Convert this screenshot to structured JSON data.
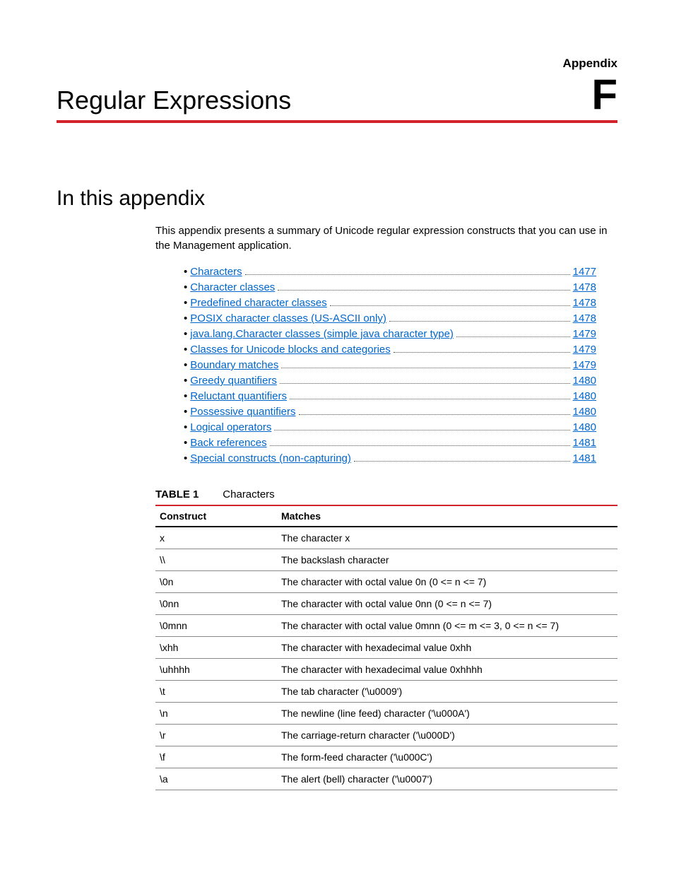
{
  "header": {
    "appendix_label": "Appendix",
    "title": "Regular Expressions",
    "letter": "F"
  },
  "section": {
    "heading": "In this appendix",
    "intro": "This appendix presents a summary of Unicode regular expression constructs that you can use in the Management application."
  },
  "toc": [
    {
      "label": "Characters",
      "page": "1477"
    },
    {
      "label": "Character classes",
      "page": "1478"
    },
    {
      "label": "Predefined character classes",
      "page": "1478"
    },
    {
      "label": "POSIX character classes (US-ASCII only)",
      "page": "1478"
    },
    {
      "label": "java.lang.Character classes (simple java character type)",
      "page": "1479"
    },
    {
      "label": "Classes for Unicode blocks and categories",
      "page": "1479"
    },
    {
      "label": "Boundary matches",
      "page": "1479"
    },
    {
      "label": "Greedy quantifiers",
      "page": "1480"
    },
    {
      "label": "Reluctant quantifiers",
      "page": "1480"
    },
    {
      "label": "Possessive quantifiers",
      "page": "1480"
    },
    {
      "label": "Logical operators",
      "page": "1480"
    },
    {
      "label": "Back references",
      "page": "1481"
    },
    {
      "label": "Special constructs (non-capturing)",
      "page": "1481"
    }
  ],
  "table": {
    "label": "TABLE 1",
    "name": "Characters",
    "headers": {
      "col1": "Construct",
      "col2": "Matches"
    },
    "rows": [
      {
        "c": "x",
        "m": "The character x"
      },
      {
        "c": "\\\\",
        "m": "The backslash character"
      },
      {
        "c": "\\0n",
        "m": "The character with octal value 0n (0 <= n <= 7)"
      },
      {
        "c": "\\0nn",
        "m": "The character with octal value 0nn (0 <= n <= 7)"
      },
      {
        "c": "\\0mnn",
        "m": "The character with octal value 0mnn (0 <= m <= 3, 0 <= n <= 7)"
      },
      {
        "c": "\\xhh",
        "m": "The character with hexadecimal value 0xhh"
      },
      {
        "c": "\\uhhhh",
        "m": "The character with hexadecimal value 0xhhhh"
      },
      {
        "c": "\\t",
        "m": "The tab character ('\\u0009')"
      },
      {
        "c": "\\n",
        "m": "The newline (line feed) character ('\\u000A')"
      },
      {
        "c": "\\r",
        "m": "The carriage-return character ('\\u000D')"
      },
      {
        "c": "\\f",
        "m": "The form-feed character ('\\u000C')"
      },
      {
        "c": "\\a",
        "m": "The alert (bell) character ('\\u0007')"
      }
    ]
  }
}
